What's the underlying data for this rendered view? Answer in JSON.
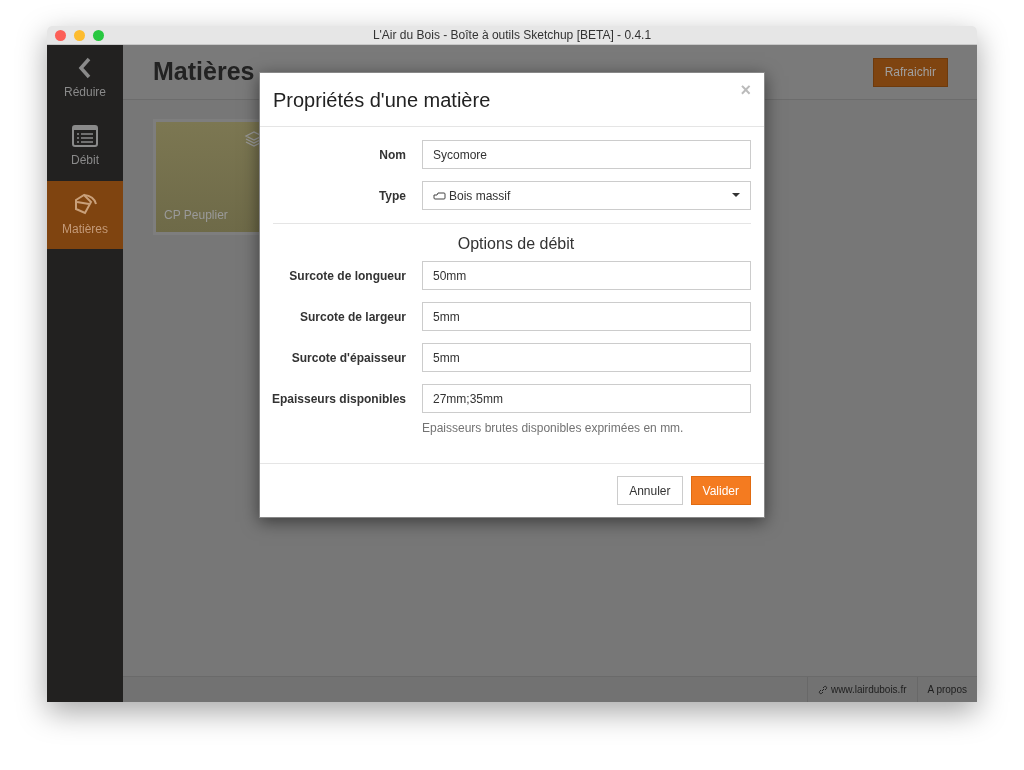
{
  "window": {
    "title": "L'Air du Bois - Boîte à outils Sketchup [BETA] - 0.4.1"
  },
  "sidebar": {
    "items": [
      {
        "kind": "back",
        "label": "Réduire",
        "selected": false
      },
      {
        "kind": "list",
        "label": "Débit",
        "selected": false
      },
      {
        "kind": "paint",
        "label": "Matières",
        "selected": true
      }
    ]
  },
  "page": {
    "title": "Matières",
    "refresh_button": "Rafraichir",
    "materials": [
      {
        "name": "CP Peuplier"
      }
    ]
  },
  "footer": {
    "links": [
      {
        "kind": "link",
        "label": "www.lairdubois.fr"
      },
      {
        "kind": "plain",
        "label": "A propos"
      }
    ]
  },
  "dialog": {
    "title": "Propriétés d'une matière",
    "close": "×",
    "fields": [
      {
        "kind": "text",
        "label": "Nom",
        "value": "Sycomore"
      },
      {
        "kind": "select",
        "label": "Type",
        "value": "Bois massif"
      }
    ],
    "section": "Options de débit",
    "options": [
      {
        "label": "Surcote de longueur",
        "value": "50mm"
      },
      {
        "label": "Surcote de largeur",
        "value": "5mm"
      },
      {
        "label": "Surcote d'épaisseur",
        "value": "5mm"
      },
      {
        "label": "Epaisseurs disponibles",
        "value": "27mm;35mm",
        "help": "Epaisseurs brutes disponibles exprimées en mm."
      }
    ],
    "buttons": [
      {
        "kind": "default",
        "label": "Annuler"
      },
      {
        "kind": "primary",
        "label": "Valider"
      }
    ]
  }
}
